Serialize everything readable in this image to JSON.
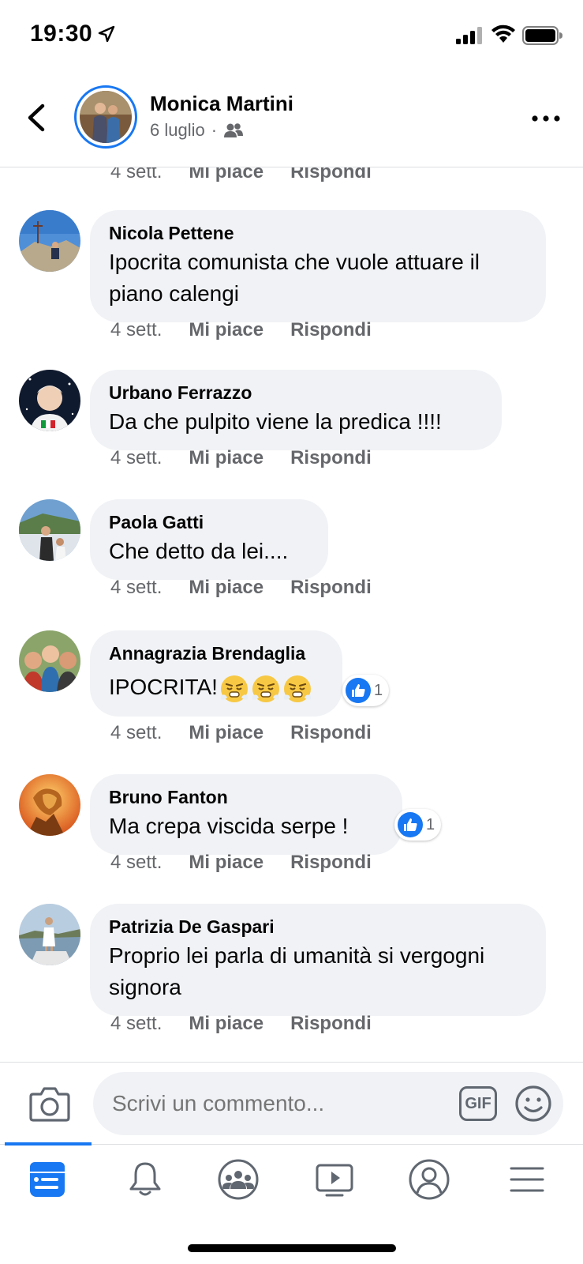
{
  "status_bar": {
    "time": "19:30"
  },
  "header": {
    "name": "Monica Martini",
    "date": "6 luglio",
    "separator": "·"
  },
  "top_meta": {
    "time": "4 sett.",
    "like": "Mi piace",
    "reply": "Rispondi"
  },
  "comments": [
    {
      "author": "Nicola Pettene",
      "text_lines": [
        "Ipocrita comunista che vuole attuare il",
        "piano calengi"
      ],
      "time": "4 sett.",
      "like": "Mi piace",
      "reply": "Rispondi"
    },
    {
      "author": "Urbano Ferrazzo",
      "text_lines": [
        "Da che pulpito viene la predica !!!!"
      ],
      "time": "4 sett.",
      "like": "Mi piace",
      "reply": "Rispondi"
    },
    {
      "author": "Paola Gatti",
      "text_lines": [
        "Che detto da lei...."
      ],
      "time": "4 sett.",
      "like": "Mi piace",
      "reply": "Rispondi"
    },
    {
      "author": "Annagrazia Brendaglia",
      "text_lines": [
        "IPOCRITA!"
      ],
      "emoji": [
        "face-steam-icon",
        "face-steam-icon",
        "face-steam-icon"
      ],
      "reaction_count": "1",
      "time": "4 sett.",
      "like": "Mi piace",
      "reply": "Rispondi"
    },
    {
      "author": "Bruno Fanton",
      "text_lines": [
        "Ma crepa viscida serpe !"
      ],
      "reaction_count": "1",
      "time": "4 sett.",
      "like": "Mi piace",
      "reply": "Rispondi"
    },
    {
      "author": "Patrizia De Gaspari",
      "text_lines": [
        "Proprio lei parla di umanità si vergogni",
        "signora"
      ],
      "time": "4 sett.",
      "like": "Mi piace",
      "reply": "Rispondi"
    }
  ],
  "composer": {
    "placeholder": "Scrivi un commento...",
    "gif_label": "GIF"
  },
  "tabs": [
    "news-feed-icon",
    "bell-icon",
    "groups-icon",
    "watch-icon",
    "profile-icon",
    "menu-icon"
  ],
  "colors": {
    "accent": "#1877f2",
    "bubble": "#f0f2f5",
    "secondary_text": "#65676b"
  }
}
